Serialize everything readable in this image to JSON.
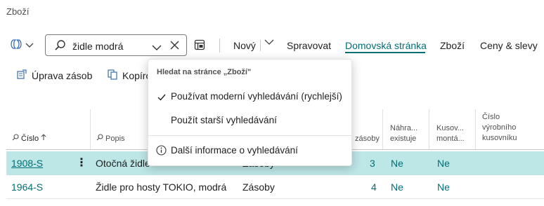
{
  "page": {
    "title": "Zboží"
  },
  "search": {
    "value": "židle modrá"
  },
  "actionbar": {
    "new_label": "Nový",
    "manage_label": "Spravovat",
    "home_label": "Domovská stránka",
    "items_label": "Zboží",
    "prices_label": "Ceny & slevy"
  },
  "row2": {
    "adjust_label": "Úprava zásob",
    "copy_label": "Kopíro"
  },
  "dropdown": {
    "heading": "Hledat na stránce „Zboží\"",
    "option_modern": "Používat moderní vyhledávání (rychlejší)",
    "option_legacy": "Použít starší vyhledávání",
    "more_info": "Další informace o vyhledávání"
  },
  "table": {
    "headers": {
      "number": "Číslo",
      "description": "Popis",
      "inventory": "zásoby",
      "substitutes_1": "Náhra...",
      "substitutes_2": "existuje",
      "assembly_1": "Kusov...",
      "assembly_2": "montá...",
      "bom_1": "Číslo",
      "bom_2": "výrobního",
      "bom_3": "kusovníku"
    },
    "rows": [
      {
        "number": "1908-S",
        "description": "Otočná židle",
        "type": "Zásoby",
        "inventory": "3",
        "substitutes": "Ne",
        "assembly": "Ne"
      },
      {
        "number": "1964-S",
        "description": "Židle pro hosty TOKIO, modrá",
        "type": "Zásoby",
        "inventory": "4",
        "substitutes": "Ne",
        "assembly": "Ne"
      }
    ]
  },
  "colors": {
    "accent": "#006f74",
    "selected_row": "#bde6e6"
  }
}
